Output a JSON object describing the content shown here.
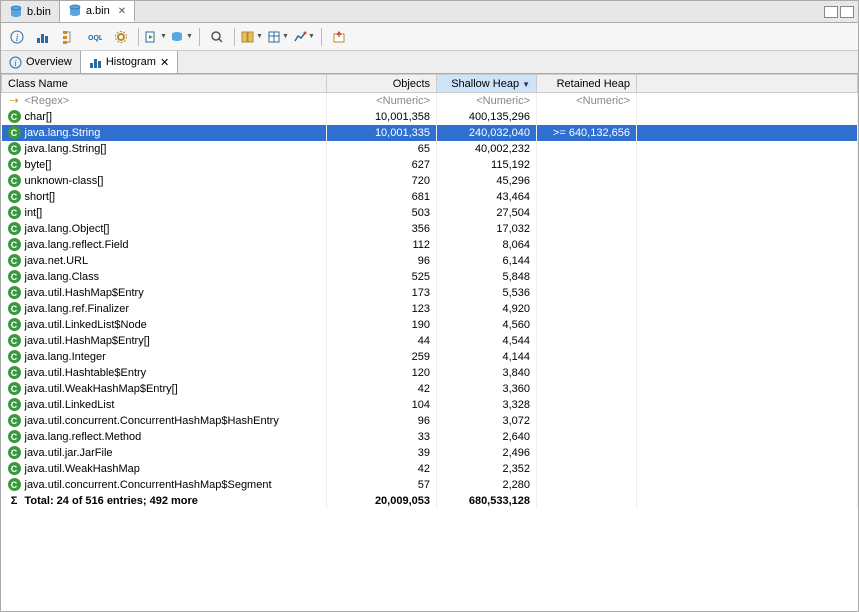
{
  "fileTabs": [
    {
      "label": "b.bin",
      "active": false
    },
    {
      "label": "a.bin",
      "active": true
    }
  ],
  "subTabs": [
    {
      "label": "Overview",
      "icon": "info",
      "active": false
    },
    {
      "label": "Histogram",
      "icon": "bars",
      "active": true
    }
  ],
  "columns": {
    "className": "Class Name",
    "objects": "Objects",
    "shallowHeap": "Shallow Heap",
    "retainedHeap": "Retained Heap"
  },
  "filterRow": {
    "classText": "<Regex>",
    "numericText": "<Numeric>"
  },
  "rows": [
    {
      "name": "char[]",
      "objects": "10,001,358",
      "shallow": "400,135,296",
      "retained": "",
      "selected": false
    },
    {
      "name": "java.lang.String",
      "objects": "10,001,335",
      "shallow": "240,032,040",
      "retained": ">= 640,132,656",
      "selected": true
    },
    {
      "name": "java.lang.String[]",
      "objects": "65",
      "shallow": "40,002,232",
      "retained": "",
      "selected": false
    },
    {
      "name": "byte[]",
      "objects": "627",
      "shallow": "115,192",
      "retained": "",
      "selected": false
    },
    {
      "name": "unknown-class[]",
      "objects": "720",
      "shallow": "45,296",
      "retained": "",
      "selected": false
    },
    {
      "name": "short[]",
      "objects": "681",
      "shallow": "43,464",
      "retained": "",
      "selected": false
    },
    {
      "name": "int[]",
      "objects": "503",
      "shallow": "27,504",
      "retained": "",
      "selected": false
    },
    {
      "name": "java.lang.Object[]",
      "objects": "356",
      "shallow": "17,032",
      "retained": "",
      "selected": false
    },
    {
      "name": "java.lang.reflect.Field",
      "objects": "112",
      "shallow": "8,064",
      "retained": "",
      "selected": false
    },
    {
      "name": "java.net.URL",
      "objects": "96",
      "shallow": "6,144",
      "retained": "",
      "selected": false
    },
    {
      "name": "java.lang.Class",
      "objects": "525",
      "shallow": "5,848",
      "retained": "",
      "selected": false
    },
    {
      "name": "java.util.HashMap$Entry",
      "objects": "173",
      "shallow": "5,536",
      "retained": "",
      "selected": false
    },
    {
      "name": "java.lang.ref.Finalizer",
      "objects": "123",
      "shallow": "4,920",
      "retained": "",
      "selected": false
    },
    {
      "name": "java.util.LinkedList$Node",
      "objects": "190",
      "shallow": "4,560",
      "retained": "",
      "selected": false
    },
    {
      "name": "java.util.HashMap$Entry[]",
      "objects": "44",
      "shallow": "4,544",
      "retained": "",
      "selected": false
    },
    {
      "name": "java.lang.Integer",
      "objects": "259",
      "shallow": "4,144",
      "retained": "",
      "selected": false
    },
    {
      "name": "java.util.Hashtable$Entry",
      "objects": "120",
      "shallow": "3,840",
      "retained": "",
      "selected": false
    },
    {
      "name": "java.util.WeakHashMap$Entry[]",
      "objects": "42",
      "shallow": "3,360",
      "retained": "",
      "selected": false
    },
    {
      "name": "java.util.LinkedList",
      "objects": "104",
      "shallow": "3,328",
      "retained": "",
      "selected": false
    },
    {
      "name": "java.util.concurrent.ConcurrentHashMap$HashEntry",
      "objects": "96",
      "shallow": "3,072",
      "retained": "",
      "selected": false
    },
    {
      "name": "java.lang.reflect.Method",
      "objects": "33",
      "shallow": "2,640",
      "retained": "",
      "selected": false
    },
    {
      "name": "java.util.jar.JarFile",
      "objects": "39",
      "shallow": "2,496",
      "retained": "",
      "selected": false
    },
    {
      "name": "java.util.WeakHashMap",
      "objects": "42",
      "shallow": "2,352",
      "retained": "",
      "selected": false
    },
    {
      "name": "java.util.concurrent.ConcurrentHashMap$Segment",
      "objects": "57",
      "shallow": "2,280",
      "retained": "",
      "selected": false
    }
  ],
  "totalRow": {
    "label": "Total: 24 of 516 entries; 492 more",
    "objects": "20,009,053",
    "shallow": "680,533,128",
    "retained": ""
  }
}
